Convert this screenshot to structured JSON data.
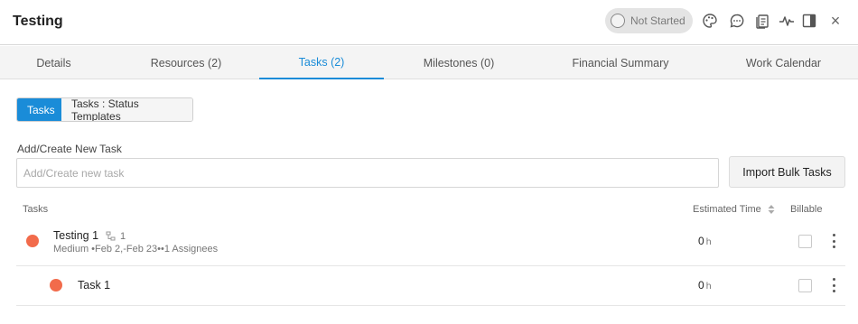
{
  "header": {
    "title": "Testing",
    "status_label": "Not Started",
    "icons": [
      "palette-icon",
      "comment-icon",
      "documents-icon",
      "activity-icon",
      "panel-toggle-icon",
      "close-icon"
    ],
    "close_glyph": "×"
  },
  "tabs": [
    {
      "label": "Details",
      "active": false
    },
    {
      "label": "Resources (2)",
      "active": false
    },
    {
      "label": "Tasks (2)",
      "active": true
    },
    {
      "label": "Milestones (0)",
      "active": false
    },
    {
      "label": "Financial Summary",
      "active": false
    },
    {
      "label": "Work Calendar",
      "active": false
    }
  ],
  "segment": {
    "tasks_label": "Tasks",
    "templates_label": "Tasks : Status Templates",
    "active": "tasks"
  },
  "new_task": {
    "label": "Add/Create New Task",
    "placeholder": "Add/Create new task",
    "value": ""
  },
  "import_label": "Import Bulk Tasks",
  "table": {
    "col_tasks": "Tasks",
    "col_estimated": "Estimated Time",
    "col_billable": "Billable",
    "rows": [
      {
        "name": "Testing 1",
        "subtask_count": "1",
        "meta": "Medium •Feb 2,-Feb 23••1 Assignees",
        "est_value": "0",
        "est_unit": "h",
        "billable": false,
        "status_color": "#f26b4b"
      },
      {
        "name": "Task 1",
        "est_value": "0",
        "est_unit": "h",
        "billable": false,
        "status_color": "#f26b4b"
      }
    ]
  },
  "colors": {
    "accent": "#1a8cd8",
    "status_dot": "#f26b4b"
  }
}
